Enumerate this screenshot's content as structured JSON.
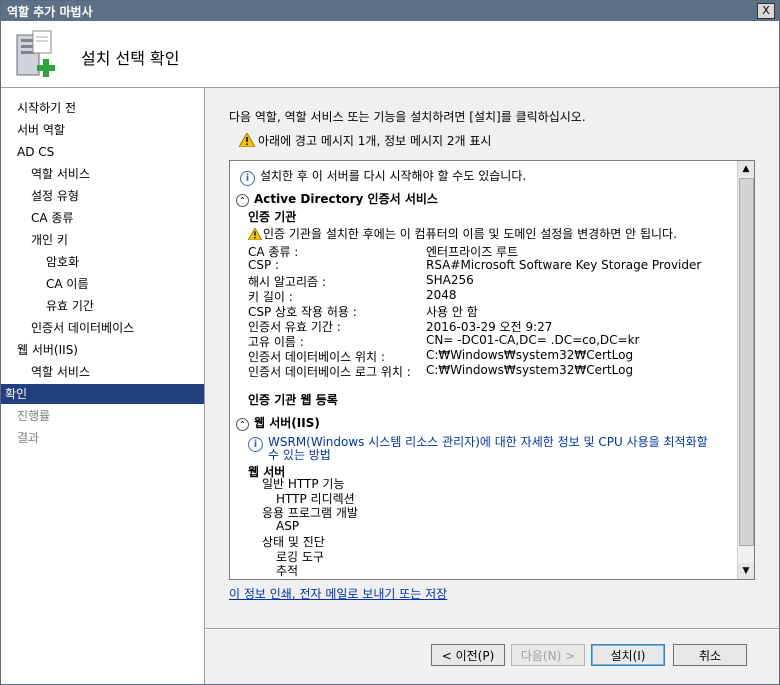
{
  "window": {
    "title": "역할 추가 마법사",
    "close_label": "X"
  },
  "banner": {
    "heading": "설치 선택 확인"
  },
  "nav": {
    "items": [
      {
        "label": "시작하기 전"
      },
      {
        "label": "서버 역할"
      },
      {
        "label": "AD CS"
      },
      {
        "label": "역할 서비스"
      },
      {
        "label": "설정 유형"
      },
      {
        "label": "CA 종류"
      },
      {
        "label": "개인 키"
      },
      {
        "label": "암호화"
      },
      {
        "label": "CA 이름"
      },
      {
        "label": "유효 기간"
      },
      {
        "label": "인증서 데이터베이스"
      },
      {
        "label": "웹 서버(IIS)"
      },
      {
        "label": "역할 서비스"
      },
      {
        "label": "확인"
      },
      {
        "label": "진행률"
      },
      {
        "label": "결과"
      }
    ]
  },
  "main": {
    "intro": "다음 역할, 역할 서비스 또는 기능을 설치하려면 [설치]를 클릭하십시오.",
    "warning_summary": "아래에 경고 메시지 1개, 정보 메시지 2개 표시",
    "restart_info": "설치한 후 이 서버를 다시 시작해야 할 수도 있습니다.",
    "adcs": {
      "header": "Active Directory 인증서 서비스",
      "ca_title": "인증 기관",
      "ca_warning": "인증 기관을 설치한 후에는 이 컴퓨터의 이름 및 도메인 설정을 변경하면 안 됩니다.",
      "rows": [
        {
          "label": "CA 종류 :",
          "value": "엔터프라이즈 루트"
        },
        {
          "label": "CSP :",
          "value": "RSA#Microsoft Software Key Storage Provider"
        },
        {
          "label": "해시 알고리즘 :",
          "value": "SHA256"
        },
        {
          "label": "키 길이 :",
          "value": "2048"
        },
        {
          "label": "CSP 상호 작용 허용 :",
          "value": "사용 안 함"
        },
        {
          "label": "인증서 유효 기간 :",
          "value": "2016-03-29 오전 9:27"
        },
        {
          "label": "고유 이름 :",
          "value": "CN=      -DC01-CA,DC=      .DC=co,DC=kr"
        },
        {
          "label": "인증서 데이터베이스 위치 :",
          "value": "C:₩Windows₩system32₩CertLog"
        },
        {
          "label": "인증서 데이터베이스 로그 위치 :",
          "value": "C:₩Windows₩system32₩CertLog"
        }
      ],
      "web_enrollment": "인증 기관 웹 등록"
    },
    "iis": {
      "header": "웹 서버(IIS)",
      "wsrm_line1": "WSRM(Windows 시스템 리소스 관리자)에 대한 자세한 정보 및 CPU 사용을 최적화할",
      "wsrm_line2": "수 있는 방법",
      "web_server": "웹 서버",
      "tree": [
        {
          "label": "일반 HTTP 기능",
          "level": 1
        },
        {
          "label": "HTTP 리디렉션",
          "level": 2
        },
        {
          "label": "응용 프로그램 개발",
          "level": 1
        },
        {
          "label": "ASP",
          "level": 2
        },
        {
          "label": "상태 및 진단",
          "level": 1
        },
        {
          "label": "로깅 도구",
          "level": 2
        },
        {
          "label": "추적",
          "level": 2
        }
      ]
    },
    "print_link": "이 정보 인쇄, 전자 메일로 보내기 또는 저장"
  },
  "buttons": {
    "prev": "< 이전(P)",
    "next": "다음(N) >",
    "install": "설치(I)",
    "cancel": "취소"
  },
  "colors": {
    "selected_nav": "#243f7e",
    "titlebar": "#5c7088",
    "link": "#0033aa"
  }
}
